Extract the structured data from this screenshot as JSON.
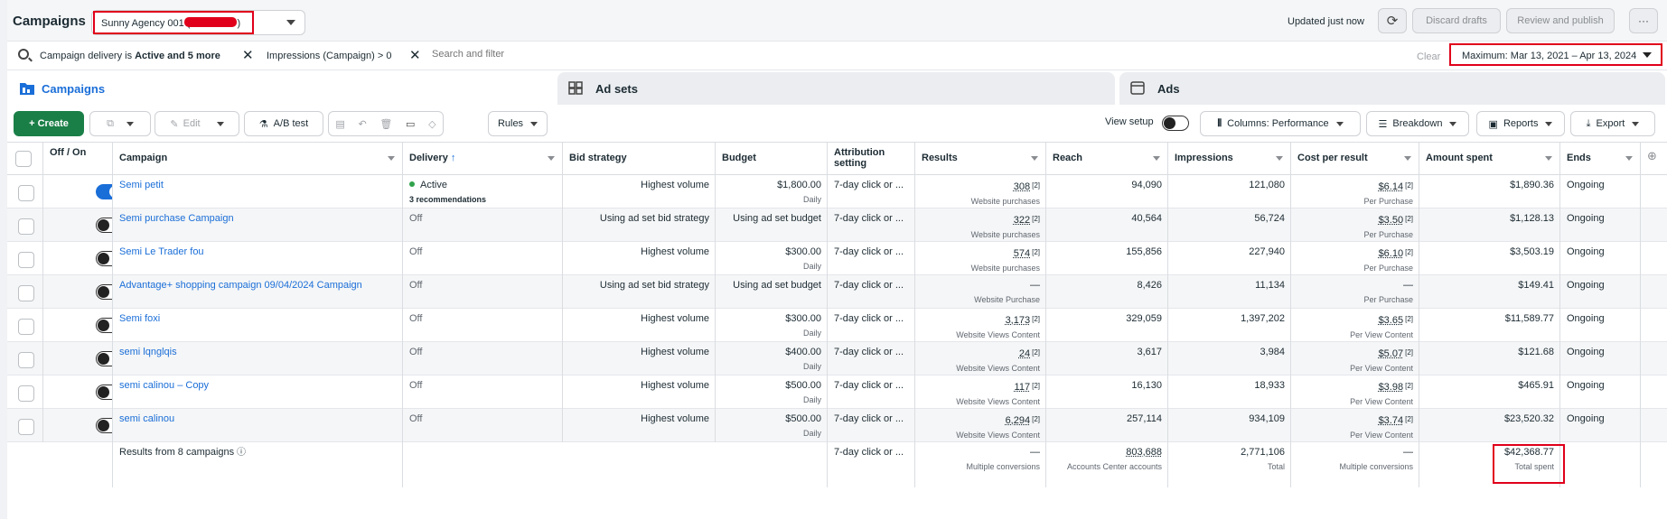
{
  "header": {
    "title": "Campaigns",
    "account_name": "Sunny Agency 001 (",
    "account_suffix": ")",
    "updated": "Updated just now",
    "discard": "Discard drafts",
    "review": "Review and publish",
    "more": "···"
  },
  "filters": {
    "chip1_prefix": "Campaign delivery is",
    "chip1_bold": "Active and 5 more",
    "chip2": "Impressions (Campaign) > 0",
    "search_placeholder": "Search and filter",
    "clear": "Clear",
    "date_range": "Maximum: Mar 13, 2021 – Apr 13, 2024"
  },
  "tabs": [
    {
      "label": "Campaigns"
    },
    {
      "label": "Ad sets"
    },
    {
      "label": "Ads"
    }
  ],
  "toolbar": {
    "create": "+ Create",
    "edit": "Edit",
    "ab_test": "A/B test",
    "rules": "Rules",
    "view_setup": "View setup",
    "columns": "Columns: Performance",
    "breakdown": "Breakdown",
    "reports": "Reports",
    "export": "Export"
  },
  "columns": {
    "off_on": "Off / On",
    "campaign": "Campaign",
    "delivery": "Delivery",
    "delivery_arrow": "↑",
    "bid_strategy": "Bid strategy",
    "budget": "Budget",
    "attribution": "Attribution setting",
    "results": "Results",
    "reach": "Reach",
    "impressions": "Impressions",
    "cpr": "Cost per result",
    "amount": "Amount spent",
    "ends": "Ends"
  },
  "rows": [
    {
      "name": "Semi petit",
      "delivery": "Active",
      "delivery_sub": "3 recommendations",
      "bid": "Highest volume",
      "budget": "$1,800.00",
      "budget_sub": "Daily",
      "attribution": "7-day click or ...",
      "results": "308",
      "results_sub": "Website purchases",
      "reach": "94,090",
      "impressions": "121,080",
      "cpr": "$6.14",
      "cpr_sub": "Per Purchase",
      "amount": "$1,890.36",
      "ends": "Ongoing"
    },
    {
      "name": "Semi purchase Campaign",
      "delivery": "Off",
      "delivery_sub": "",
      "bid": "Using ad set bid strategy",
      "budget": "Using ad set budget",
      "budget_sub": "",
      "attribution": "7-day click or ...",
      "results": "322",
      "results_sub": "Website purchases",
      "reach": "40,564",
      "impressions": "56,724",
      "cpr": "$3.50",
      "cpr_sub": "Per Purchase",
      "amount": "$1,128.13",
      "ends": "Ongoing"
    },
    {
      "name": "Semi Le Trader fou",
      "delivery": "Off",
      "delivery_sub": "",
      "bid": "Highest volume",
      "budget": "$300.00",
      "budget_sub": "Daily",
      "attribution": "7-day click or ...",
      "results": "574",
      "results_sub": "Website purchases",
      "reach": "155,856",
      "impressions": "227,940",
      "cpr": "$6.10",
      "cpr_sub": "Per Purchase",
      "amount": "$3,503.19",
      "ends": "Ongoing"
    },
    {
      "name": "Advantage+ shopping campaign 09/04/2024 Campaign",
      "delivery": "Off",
      "delivery_sub": "",
      "bid": "Using ad set bid strategy",
      "budget": "Using ad set budget",
      "budget_sub": "",
      "attribution": "7-day click or ...",
      "results": "—",
      "results_sub": "Website Purchase",
      "reach": "8,426",
      "impressions": "11,134",
      "cpr": "—",
      "cpr_sub": "Per Purchase",
      "amount": "$149.41",
      "ends": "Ongoing"
    },
    {
      "name": "Semi foxi",
      "delivery": "Off",
      "delivery_sub": "",
      "bid": "Highest volume",
      "budget": "$300.00",
      "budget_sub": "Daily",
      "attribution": "7-day click or ...",
      "results": "3,173",
      "results_sub": "Website Views Content",
      "reach": "329,059",
      "impressions": "1,397,202",
      "cpr": "$3.65",
      "cpr_sub": "Per View Content",
      "amount": "$11,589.77",
      "ends": "Ongoing"
    },
    {
      "name": "semi lqnglqis",
      "delivery": "Off",
      "delivery_sub": "",
      "bid": "Highest volume",
      "budget": "$400.00",
      "budget_sub": "Daily",
      "attribution": "7-day click or ...",
      "results": "24",
      "results_sub": "Website Views Content",
      "reach": "3,617",
      "impressions": "3,984",
      "cpr": "$5.07",
      "cpr_sub": "Per View Content",
      "amount": "$121.68",
      "ends": "Ongoing"
    },
    {
      "name": "semi calinou – Copy",
      "delivery": "Off",
      "delivery_sub": "",
      "bid": "Highest volume",
      "budget": "$500.00",
      "budget_sub": "Daily",
      "attribution": "7-day click or ...",
      "results": "117",
      "results_sub": "Website Views Content",
      "reach": "16,130",
      "impressions": "18,933",
      "cpr": "$3.98",
      "cpr_sub": "Per View Content",
      "amount": "$465.91",
      "ends": "Ongoing"
    },
    {
      "name": "semi calinou",
      "delivery": "Off",
      "delivery_sub": "",
      "bid": "Highest volume",
      "budget": "$500.00",
      "budget_sub": "Daily",
      "attribution": "7-day click or ...",
      "results": "6,294",
      "results_sub": "Website Views Content",
      "reach": "257,114",
      "impressions": "934,109",
      "cpr": "$3.74",
      "cpr_sub": "Per View Content",
      "amount": "$23,520.32",
      "ends": "Ongoing"
    }
  ],
  "summary": {
    "label": "Results from 8 campaigns",
    "attribution": "7-day click or ...",
    "results": "—",
    "results_sub": "Multiple conversions",
    "reach": "803,688",
    "reach_sub": "Accounts Center accounts",
    "impressions": "2,771,106",
    "impressions_sub": "Total",
    "cpr": "—",
    "cpr_sub": "Multiple conversions",
    "amount": "$42,368.77",
    "amount_sub": "Total spent"
  },
  "colors": {
    "brand_blue": "#1a6ed8",
    "create_green": "#1a7f47",
    "highlight_red": "#e0001b",
    "active_dot": "#31a24c"
  }
}
